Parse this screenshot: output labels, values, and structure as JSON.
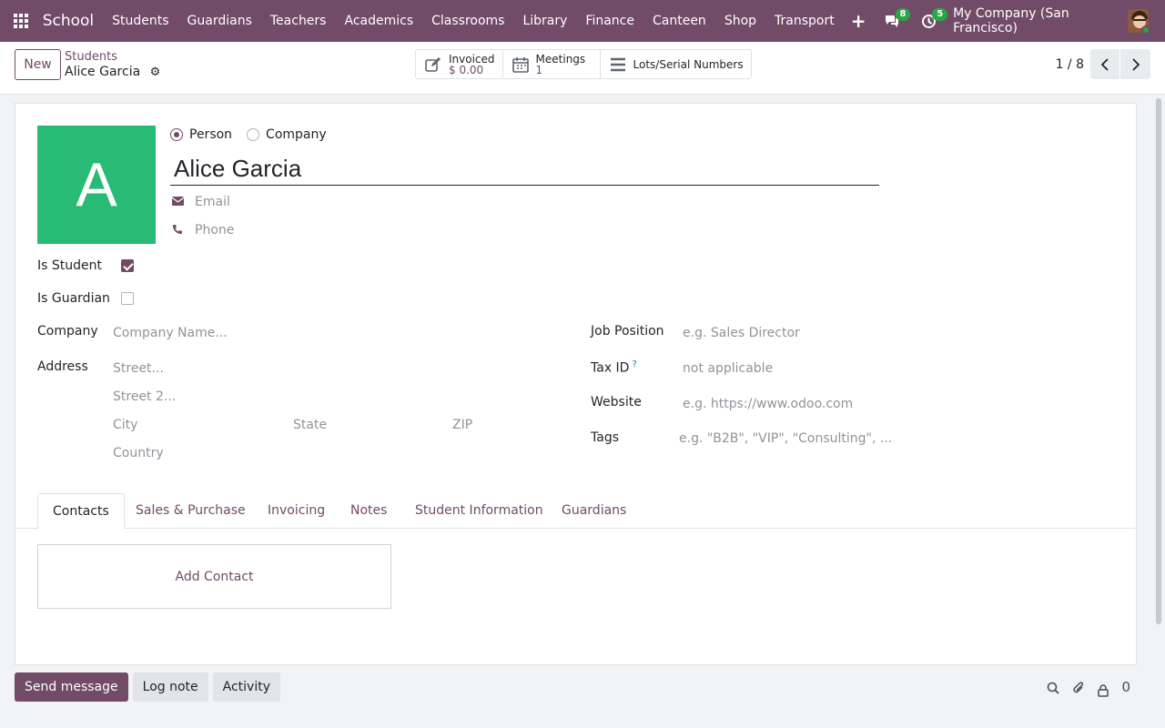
{
  "navbar": {
    "brand": "School",
    "menu": [
      "Students",
      "Guardians",
      "Teachers",
      "Academics",
      "Classrooms",
      "Library",
      "Finance",
      "Canteen",
      "Shop",
      "Transport"
    ],
    "messages_count": "8",
    "activities_count": "5",
    "company": "My Company (San Francisco)"
  },
  "control": {
    "new_label": "New",
    "breadcrumb_parent": "Students",
    "breadcrumb_current": "Alice Garcia",
    "smart_buttons": {
      "invoiced_label": "Invoiced",
      "invoiced_value": "$ 0.00",
      "meetings_label": "Meetings",
      "meetings_value": "1",
      "lots_label": "Lots/Serial Numbers"
    },
    "pager": "1 / 8"
  },
  "form": {
    "avatar_letter": "A",
    "type_person": "Person",
    "type_company": "Company",
    "name": "Alice Garcia",
    "email_placeholder": "Email",
    "phone_placeholder": "Phone",
    "is_student_label": "Is Student",
    "is_student": true,
    "is_guardian_label": "Is Guardian",
    "is_guardian": false,
    "company_label": "Company",
    "company_placeholder": "Company Name...",
    "address_label": "Address",
    "street_placeholder": "Street...",
    "street2_placeholder": "Street 2...",
    "city_placeholder": "City",
    "state_placeholder": "State",
    "zip_placeholder": "ZIP",
    "country_placeholder": "Country",
    "job_position_label": "Job Position",
    "job_position_placeholder": "e.g. Sales Director",
    "tax_id_label": "Tax ID",
    "tax_id_help": "?",
    "tax_id_placeholder": "not applicable",
    "website_label": "Website",
    "website_placeholder": "e.g. https://www.odoo.com",
    "tags_label": "Tags",
    "tags_placeholder": "e.g. \"B2B\", \"VIP\", \"Consulting\", ..."
  },
  "tabs": [
    "Contacts",
    "Sales & Purchase",
    "Invoicing",
    "Notes",
    "Student Information",
    "Guardians"
  ],
  "contacts_tab": {
    "add_contact": "Add Contact"
  },
  "chatter": {
    "send_message": "Send message",
    "log_note": "Log note",
    "activity": "Activity",
    "followers_count": "0"
  },
  "colors": {
    "brand": "#714b67",
    "avatar_bg": "#27bb75",
    "badge": "#28a745"
  }
}
